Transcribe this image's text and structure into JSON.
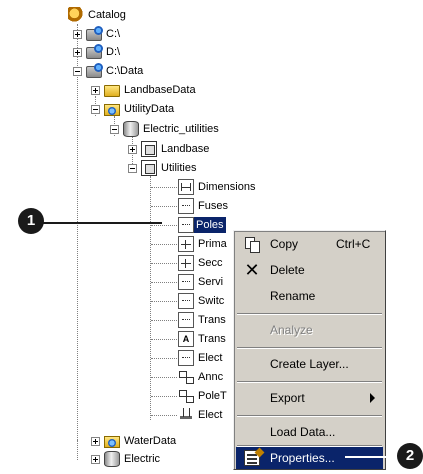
{
  "tree": {
    "catalog": "Catalog",
    "c_drive": "C:\\",
    "d_drive": "D:\\",
    "c_data": "C:\\Data",
    "landbase_data": "LandbaseData",
    "utility_data": "UtilityData",
    "electric_utilities": "Electric_utilities",
    "landbase": "Landbase",
    "utilities": "Utilities",
    "dimensions": "Dimensions",
    "fuses": "Fuses",
    "poles": "Poles",
    "prima": "Prima",
    "secc": "Secc",
    "servi": "Servi",
    "switc": "Switc",
    "trans1": "Trans",
    "trans2": "Trans",
    "elect1": "Elect",
    "annc": "Annc",
    "polet": "PoleT",
    "elect2": "Elect",
    "water_data": "WaterData",
    "electric": "Electric"
  },
  "menu": {
    "copy": "Copy",
    "copy_shortcut": "Ctrl+C",
    "delete": "Delete",
    "rename": "Rename",
    "analyze": "Analyze",
    "create_layer": "Create Layer...",
    "export": "Export",
    "load_data": "Load Data...",
    "properties": "Properties..."
  },
  "callouts": {
    "step1": "1",
    "step2": "2"
  },
  "colors": {
    "selection": "#0a246a",
    "menu_bg": "#d4d0c8",
    "callout": "#1a1a1a"
  }
}
